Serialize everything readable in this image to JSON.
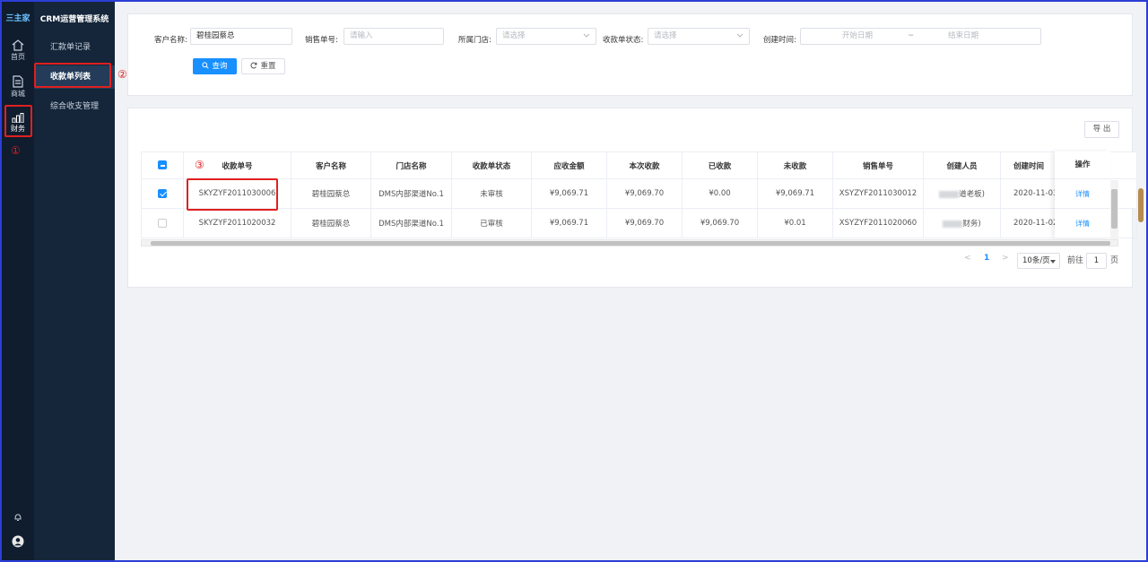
{
  "brand": {
    "logo_text": "三主家",
    "system_title": "CRM运营管理系统"
  },
  "rail": {
    "items": [
      {
        "label": "首页",
        "icon": "home-icon"
      },
      {
        "label": "商城",
        "icon": "document-icon"
      },
      {
        "label": "财务",
        "icon": "bar-chart-icon"
      }
    ],
    "bottom_icons": [
      "bell-icon",
      "user-avatar-icon"
    ]
  },
  "subnav": {
    "items": [
      {
        "label": "汇款单记录"
      },
      {
        "label": "收款单列表"
      },
      {
        "label": "综合收支管理"
      }
    ]
  },
  "annotations": {
    "one": "①",
    "two": "②",
    "three": "③"
  },
  "filters": {
    "customer_label": "客户名称:",
    "customer_value": "碧桂园蔡总",
    "sales_no_label": "销售单号:",
    "sales_no_placeholder": "请输入",
    "store_label": "所属门店:",
    "store_placeholder": "请选择",
    "status_label": "收款单状态:",
    "status_placeholder": "请选择",
    "created_label": "创建时间:",
    "start_placeholder": "开始日期",
    "range_sep": "~",
    "end_placeholder": "结束日期",
    "search_btn": "查询",
    "reset_btn": "重置"
  },
  "toolbar": {
    "export_btn": "导 出"
  },
  "table": {
    "headers": [
      "收款单号",
      "客户名称",
      "门店名称",
      "收款单状态",
      "应收金额",
      "本次收款",
      "已收款",
      "未收款",
      "销售单号",
      "创建人员",
      "创建时间"
    ],
    "op_header": "操作",
    "rows": [
      {
        "checked": true,
        "no": "SKYZYF2011030006",
        "customer": "碧桂园蔡总",
        "store": "DMS内部渠道No.1",
        "status": "未审核",
        "due": "¥9,069.71",
        "this": "¥9,069.70",
        "received": "¥0.00",
        "unpaid": "¥9,069.71",
        "sales_no": "XSYZYF2011030012",
        "creator_suffix": "道老板)",
        "created": "2020-11-03",
        "op": "详情"
      },
      {
        "checked": false,
        "no": "SKYZYF2011020032",
        "customer": "碧桂园蔡总",
        "store": "DMS内部渠道No.1",
        "status": "已审核",
        "due": "¥9,069.71",
        "this": "¥9,069.70",
        "received": "¥9,069.70",
        "unpaid": "¥0.01",
        "sales_no": "XSYZYF2011020060",
        "creator_suffix": "财务)",
        "created": "2020-11-02",
        "op": "详情"
      }
    ]
  },
  "pagination": {
    "prev": "<",
    "page": "1",
    "next": ">",
    "page_size": "10条/页",
    "goto_label": "前往",
    "goto_value": "1",
    "page_unit": "页"
  }
}
